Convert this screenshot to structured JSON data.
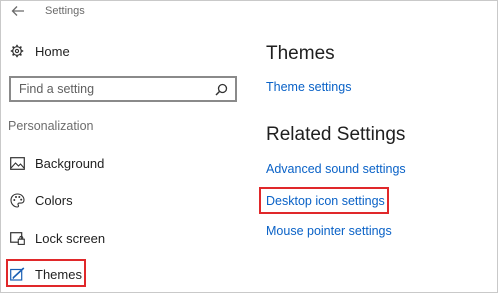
{
  "window": {
    "title": "Settings"
  },
  "nav": {
    "home_label": "Home",
    "search_placeholder": "Find a setting",
    "section_label": "Personalization",
    "items": [
      {
        "label": "Background",
        "icon": "image-icon"
      },
      {
        "label": "Colors",
        "icon": "palette-icon"
      },
      {
        "label": "Lock screen",
        "icon": "lock-screen-icon"
      },
      {
        "label": "Themes",
        "icon": "themes-brush-icon",
        "selected": true
      }
    ]
  },
  "main": {
    "heading": "Themes",
    "theme_settings_link": "Theme settings",
    "related_heading": "Related Settings",
    "related_links": [
      "Advanced sound settings",
      "Desktop icon settings",
      "Mouse pointer settings"
    ]
  },
  "colors": {
    "accent_link": "#0a62c7",
    "highlight_red": "#e0282a"
  }
}
